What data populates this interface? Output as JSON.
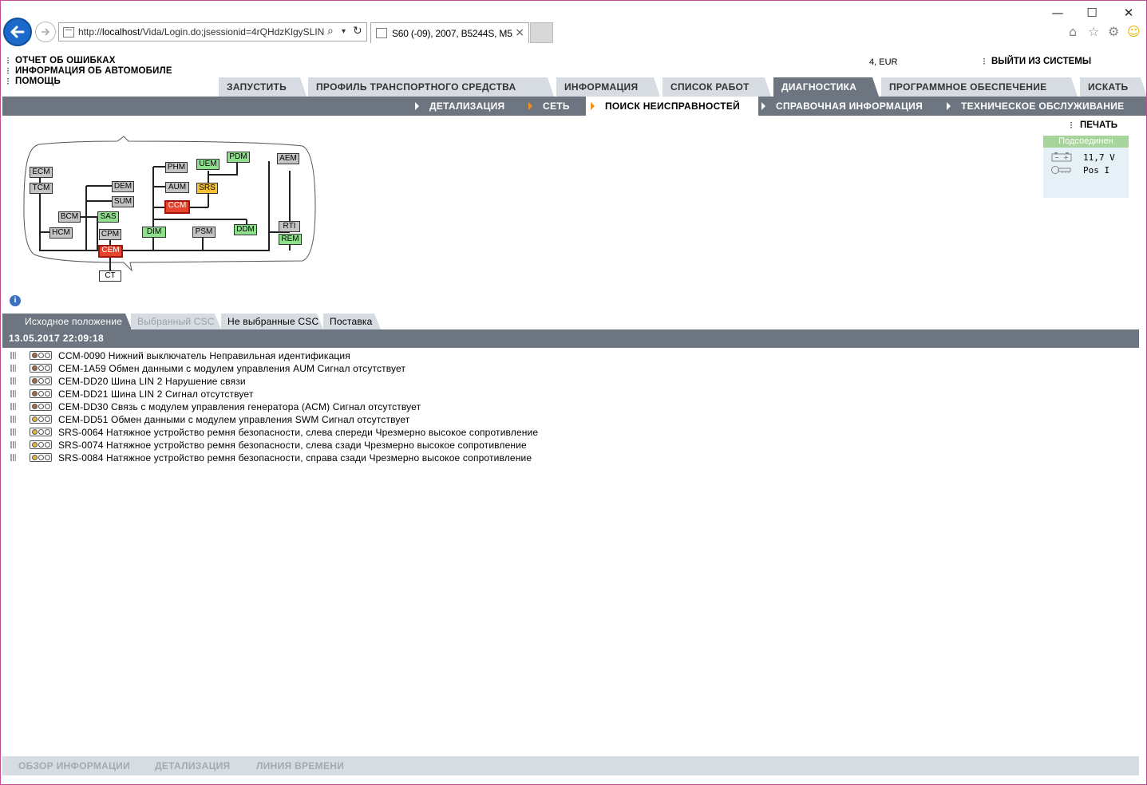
{
  "browser": {
    "url_prefix": "http://",
    "url_host": "localhost",
    "url_path": "/Vida/Login.do;jsessionid=4rQHdzKlgySLIN",
    "tab_title": "S60 (-09), 2007, B5244S, M5...",
    "minimize": "—",
    "maximize": "☐",
    "close": "✕"
  },
  "header": {
    "links": [
      "ОТЧЕТ ОБ ОШИБКАХ",
      "ИНФОРМАЦИЯ ОБ АВТОМОБИЛЕ",
      "ПОМОЩЬ"
    ],
    "currency": "4, EUR",
    "logout": "ВЫЙТИ ИЗ СИСТЕМЫ"
  },
  "main_tabs": [
    {
      "label": "ЗАПУСТИТЬ",
      "active": false
    },
    {
      "label": "ПРОФИЛЬ ТРАНСПОРТНОГО СРЕДСТВА",
      "active": false
    },
    {
      "label": "ИНФОРМАЦИЯ",
      "active": false
    },
    {
      "label": "СПИСОК РАБОТ",
      "active": false
    },
    {
      "label": "ДИАГНОСТИКА",
      "active": true
    },
    {
      "label": "ПРОГРАММНОЕ ОБЕСПЕЧЕНИЕ",
      "active": false
    },
    {
      "label": "ИСКАТЬ",
      "active": false
    }
  ],
  "sub_nav": [
    {
      "label": "ДЕТАЛИЗАЦИЯ",
      "active": false
    },
    {
      "label": "СЕТЬ",
      "active": false
    },
    {
      "label": "ПОИСК НЕИСПРАВНОСТЕЙ",
      "active": true
    },
    {
      "label": "СПРАВОЧНАЯ ИНФОРМАЦИЯ",
      "active": false
    },
    {
      "label": "ТЕХНИЧЕСКОЕ ОБСЛУЖИВАНИЕ",
      "active": false
    }
  ],
  "print": "ПЕЧАТЬ",
  "status": {
    "header": "Подсоединен",
    "voltage": "11,7 V",
    "ignition": "Pos I"
  },
  "network": {
    "modules": {
      "ECM": "ECM",
      "TCM": "TCM",
      "BCM": "BCM",
      "SAS": "SAS",
      "HCM": "HCM",
      "DEM": "DEM",
      "SUM": "SUM",
      "CPM": "CPM",
      "CEM": "CEM",
      "CT": "CT",
      "PHM": "PHM",
      "AUM": "AUM",
      "UEM": "UEM",
      "PDM": "PDM",
      "SRS": "SRS",
      "CCM": "CCM",
      "DIM": "DIM",
      "PSM": "PSM",
      "DDM": "DDM",
      "AEM": "AEM",
      "RTI": "RTI",
      "REM": "REM"
    },
    "status_colors": {
      "ok": "#8fe08c",
      "not_responding": "#c4c4c4",
      "warning": "#f6c233",
      "fault": "#e5452d"
    }
  },
  "dtc_tabs": [
    {
      "label": "Исходное положение",
      "active": true,
      "disabled": false
    },
    {
      "label": "Выбранный CSC",
      "active": false,
      "disabled": true
    },
    {
      "label": "Не выбранные CSC",
      "active": false,
      "disabled": false
    },
    {
      "label": "Поставка",
      "active": false,
      "disabled": false
    }
  ],
  "session_date": "13.05.2017 22:09:18",
  "dtc_list": [
    {
      "text": "CCM-0090 Нижний выключатель Неправильная идентификация",
      "lamp": "brown"
    },
    {
      "text": "CEM-1A59 Обмен данными с модулем управления AUM Сигнал отсутствует",
      "lamp": "brown"
    },
    {
      "text": "CEM-DD20 Шина LIN 2 Нарушение связи",
      "lamp": "brown"
    },
    {
      "text": "CEM-DD21 Шина LIN 2 Сигнал отсутствует",
      "lamp": "brown"
    },
    {
      "text": "CEM-DD30 Связь с модулем управления генератора (ACM) Сигнал отсутствует",
      "lamp": "brown"
    },
    {
      "text": "CEM-DD51 Обмен данными с модулем управления SWM Сигнал отсутствует",
      "lamp": "yellow"
    },
    {
      "text": "SRS-0064 Натяжное устройство ремня безопасности, слева спереди Чрезмерно высокое сопротивление",
      "lamp": "yellow"
    },
    {
      "text": "SRS-0074 Натяжное устройство ремня безопасности, слева сзади Чрезмерно высокое сопротивление",
      "lamp": "yellow"
    },
    {
      "text": "SRS-0084 Натяжное устройство ремня безопасности, справа сзади Чрезмерно высокое сопротивление",
      "lamp": "yellow"
    }
  ],
  "footer": [
    "ОБЗОР ИНФОРМАЦИИ",
    "ДЕТАЛИЗАЦИЯ",
    "ЛИНИЯ ВРЕМЕНИ"
  ]
}
